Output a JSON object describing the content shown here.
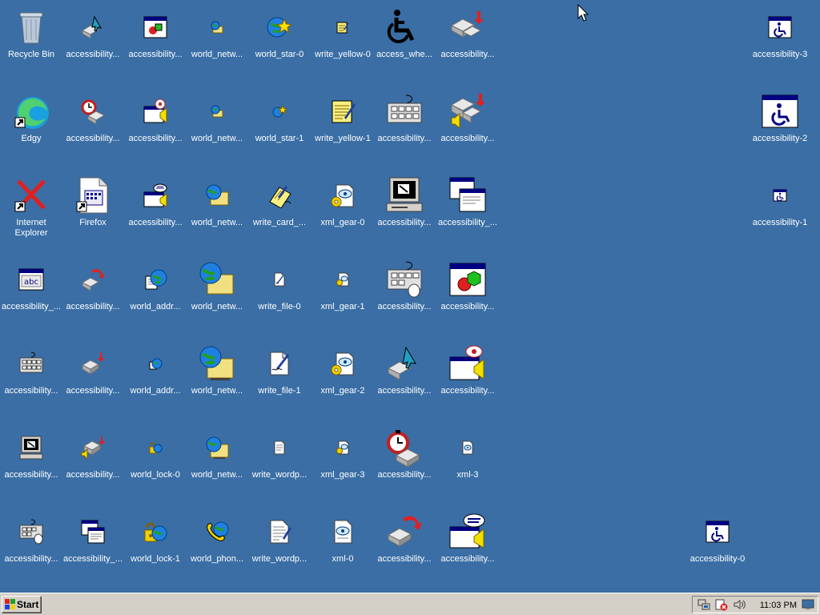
{
  "desktop": {
    "icons": [
      {
        "label": "Recycle Bin",
        "icon": "recycle-bin-icon"
      },
      {
        "label": "accessibility...",
        "icon": "accessibility-pointer-icon"
      },
      {
        "label": "accessibility...",
        "icon": "accessibility-window-shapes-icon"
      },
      {
        "label": "world_netw...",
        "icon": "world-network-icon"
      },
      {
        "label": "world_star-0",
        "icon": "world-star-icon"
      },
      {
        "label": "write_yellow-0",
        "icon": "write-yellow-icon"
      },
      {
        "label": "access_whe...",
        "icon": "wheelchair-icon"
      },
      {
        "label": "accessibility...",
        "icon": "accessibility-keys-arrow-icon"
      },
      {
        "label": "accessibility-3",
        "icon": "accessibility-window-wheelchair-icon"
      },
      {
        "label": "Edgy",
        "icon": "edge-browser-icon"
      },
      {
        "label": "accessibility...",
        "icon": "accessibility-timer-icon"
      },
      {
        "label": "accessibility...",
        "icon": "accessibility-sound-window-icon"
      },
      {
        "label": "world_netw...",
        "icon": "world-network-icon"
      },
      {
        "label": "world_star-1",
        "icon": "world-star-icon"
      },
      {
        "label": "write_yellow-1",
        "icon": "write-yellow-notepad-icon"
      },
      {
        "label": "accessibility...",
        "icon": "accessibility-keyboard-icon"
      },
      {
        "label": "accessibility...",
        "icon": "accessibility-keys-sound-icon"
      },
      {
        "label": "accessibility-2",
        "icon": "accessibility-window-wheelchair-icon"
      },
      {
        "label": "Internet Explorer",
        "icon": "internet-explorer-icon"
      },
      {
        "label": "Firefox",
        "icon": "firefox-icon"
      },
      {
        "label": "accessibility...",
        "icon": "accessibility-speech-window-icon"
      },
      {
        "label": "world_netw...",
        "icon": "world-network-icon"
      },
      {
        "label": "write_card_...",
        "icon": "write-card-icon"
      },
      {
        "label": "xml_gear-0",
        "icon": "xml-gear-icon"
      },
      {
        "label": "accessibility...",
        "icon": "accessibility-computer-icon"
      },
      {
        "label": "accessibility_...",
        "icon": "accessibility-windows-icon"
      },
      {
        "label": "accessibility-1",
        "icon": "accessibility-window-wheelchair-icon"
      },
      {
        "label": "accessibility_...",
        "icon": "accessibility-abc-icon"
      },
      {
        "label": "accessibility...",
        "icon": "accessibility-keys-refresh-icon"
      },
      {
        "label": "world_addr...",
        "icon": "world-address-book-icon"
      },
      {
        "label": "world_netw...",
        "icon": "world-network-large-icon"
      },
      {
        "label": "write_file-0",
        "icon": "write-file-icon"
      },
      {
        "label": "xml_gear-1",
        "icon": "xml-gear-icon"
      },
      {
        "label": "accessibility...",
        "icon": "accessibility-keyboard-mouse-icon"
      },
      {
        "label": "accessibility...",
        "icon": "accessibility-window-shapes-icon"
      },
      {
        "label": "accessibility...",
        "icon": "accessibility-keyboard-icon"
      },
      {
        "label": "accessibility...",
        "icon": "accessibility-keys-arrow-icon"
      },
      {
        "label": "world_addr...",
        "icon": "world-address-book-icon"
      },
      {
        "label": "world_netw...",
        "icon": "world-network-large-icon"
      },
      {
        "label": "write_file-1",
        "icon": "write-file-icon"
      },
      {
        "label": "xml_gear-2",
        "icon": "xml-gear-icon"
      },
      {
        "label": "accessibility...",
        "icon": "accessibility-pointer-icon"
      },
      {
        "label": "accessibility...",
        "icon": "accessibility-sound-window-icon"
      },
      {
        "label": "accessibility...",
        "icon": "accessibility-computer-icon"
      },
      {
        "label": "accessibility...",
        "icon": "accessibility-keys-sound-icon"
      },
      {
        "label": "world_lock-0",
        "icon": "world-lock-icon"
      },
      {
        "label": "world_netw...",
        "icon": "world-network-icon"
      },
      {
        "label": "write_wordp...",
        "icon": "write-wordpad-icon"
      },
      {
        "label": "xml_gear-3",
        "icon": "xml-gear-icon"
      },
      {
        "label": "accessibility...",
        "icon": "accessibility-timer-icon"
      },
      {
        "label": "xml-3",
        "icon": "xml-icon"
      },
      {
        "label": "accessibility...",
        "icon": "accessibility-keyboard-mouse-icon"
      },
      {
        "label": "accessibility_...",
        "icon": "accessibility-windows-icon"
      },
      {
        "label": "world_lock-1",
        "icon": "world-lock-icon"
      },
      {
        "label": "world_phon...",
        "icon": "world-phone-icon"
      },
      {
        "label": "write_wordp...",
        "icon": "write-wordpad-icon"
      },
      {
        "label": "xml-0",
        "icon": "xml-icon"
      },
      {
        "label": "accessibility...",
        "icon": "accessibility-keys-refresh-icon"
      },
      {
        "label": "accessibility...",
        "icon": "accessibility-speech-window-icon"
      },
      {
        "label": "accessibility-0",
        "icon": "accessibility-window-wheelchair-icon"
      }
    ]
  },
  "taskbar": {
    "start_label": "Start",
    "clock": "11:03 PM",
    "tray_icons": [
      "network-icon",
      "security-alert-icon",
      "volume-icon",
      "desktop-icon"
    ]
  },
  "colors": {
    "desktop_bg": "#3a6ea5",
    "taskbar_bg": "#d4d0c8",
    "label_text": "#ffffff"
  }
}
